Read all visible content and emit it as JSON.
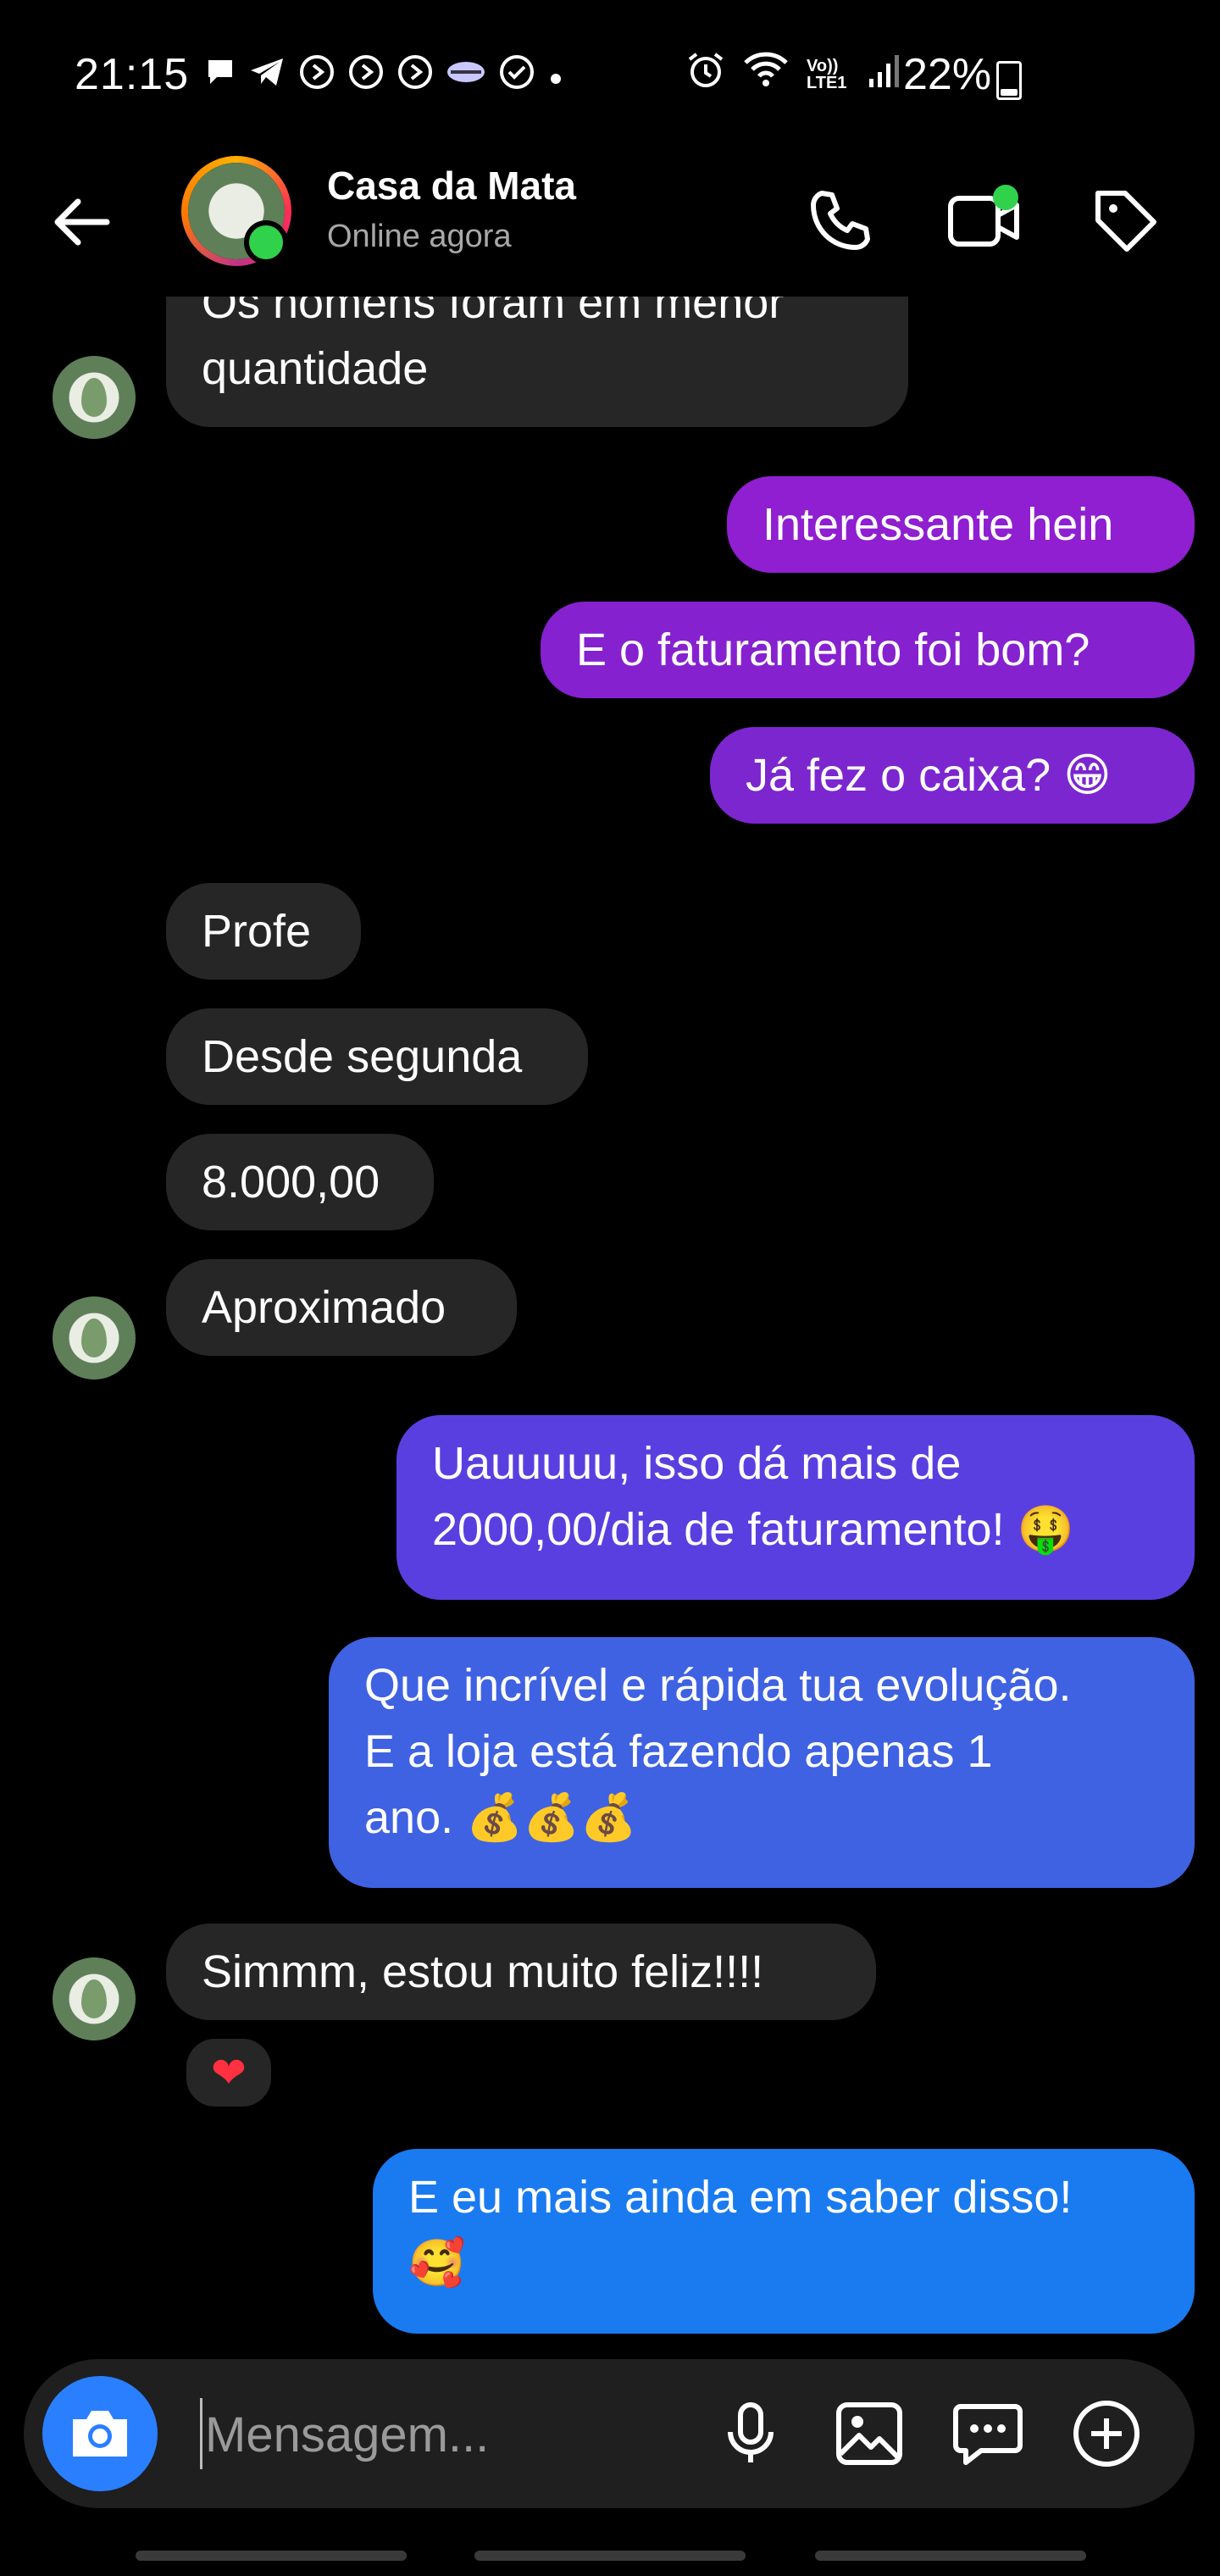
{
  "status_bar": {
    "time": "21:15",
    "network_label": "Vo)) LTE1",
    "battery_text": "22%",
    "icons": [
      "message-icon",
      "telegram-icon",
      "app-icon",
      "app-icon",
      "app-icon",
      "handshake-icon",
      "check-icon",
      "dot-icon",
      "alarm-icon",
      "wifi-icon",
      "signal-icon",
      "battery-icon"
    ]
  },
  "header": {
    "contact_name": "Casa da Mata",
    "contact_status": "Online agora"
  },
  "messages": [
    {
      "side": "in",
      "lines": [
        "Os homens foram em menor",
        "quantidade"
      ]
    },
    {
      "side": "out",
      "text": "Interessante hein"
    },
    {
      "side": "out",
      "text": "E o faturamento foi bom?"
    },
    {
      "side": "out",
      "text": "Já fez o caixa? 😁"
    },
    {
      "side": "in",
      "text": "Profe"
    },
    {
      "side": "in",
      "text": "Desde segunda"
    },
    {
      "side": "in",
      "text": "8.000,00"
    },
    {
      "side": "in",
      "text": "Aproximado"
    },
    {
      "side": "out",
      "lines": [
        "Uauuuuu,  isso dá mais de",
        "2000,00/dia de faturamento! 🤑"
      ]
    },
    {
      "side": "out",
      "lines": [
        "Que incrível e rápida tua evolução.",
        "E a loja está fazendo apenas 1",
        "ano. 💰💰💰"
      ]
    },
    {
      "side": "in",
      "text": "Simmm, estou muito feliz!!!!",
      "reaction": "❤"
    },
    {
      "side": "out",
      "lines": [
        "E eu mais ainda em saber disso!",
        "🥰"
      ]
    }
  ],
  "composer": {
    "placeholder": "Mensagem..."
  },
  "colors": {
    "incoming_bubble": "#262626",
    "outgoing_purple": "#8f1fd0",
    "outgoing_indigo": "#5a3fe0",
    "outgoing_blue": "#3a6ae0",
    "outgoing_sky": "#1a7af0",
    "online_green": "#31d24b",
    "camera_blue": "#2a7fff"
  }
}
